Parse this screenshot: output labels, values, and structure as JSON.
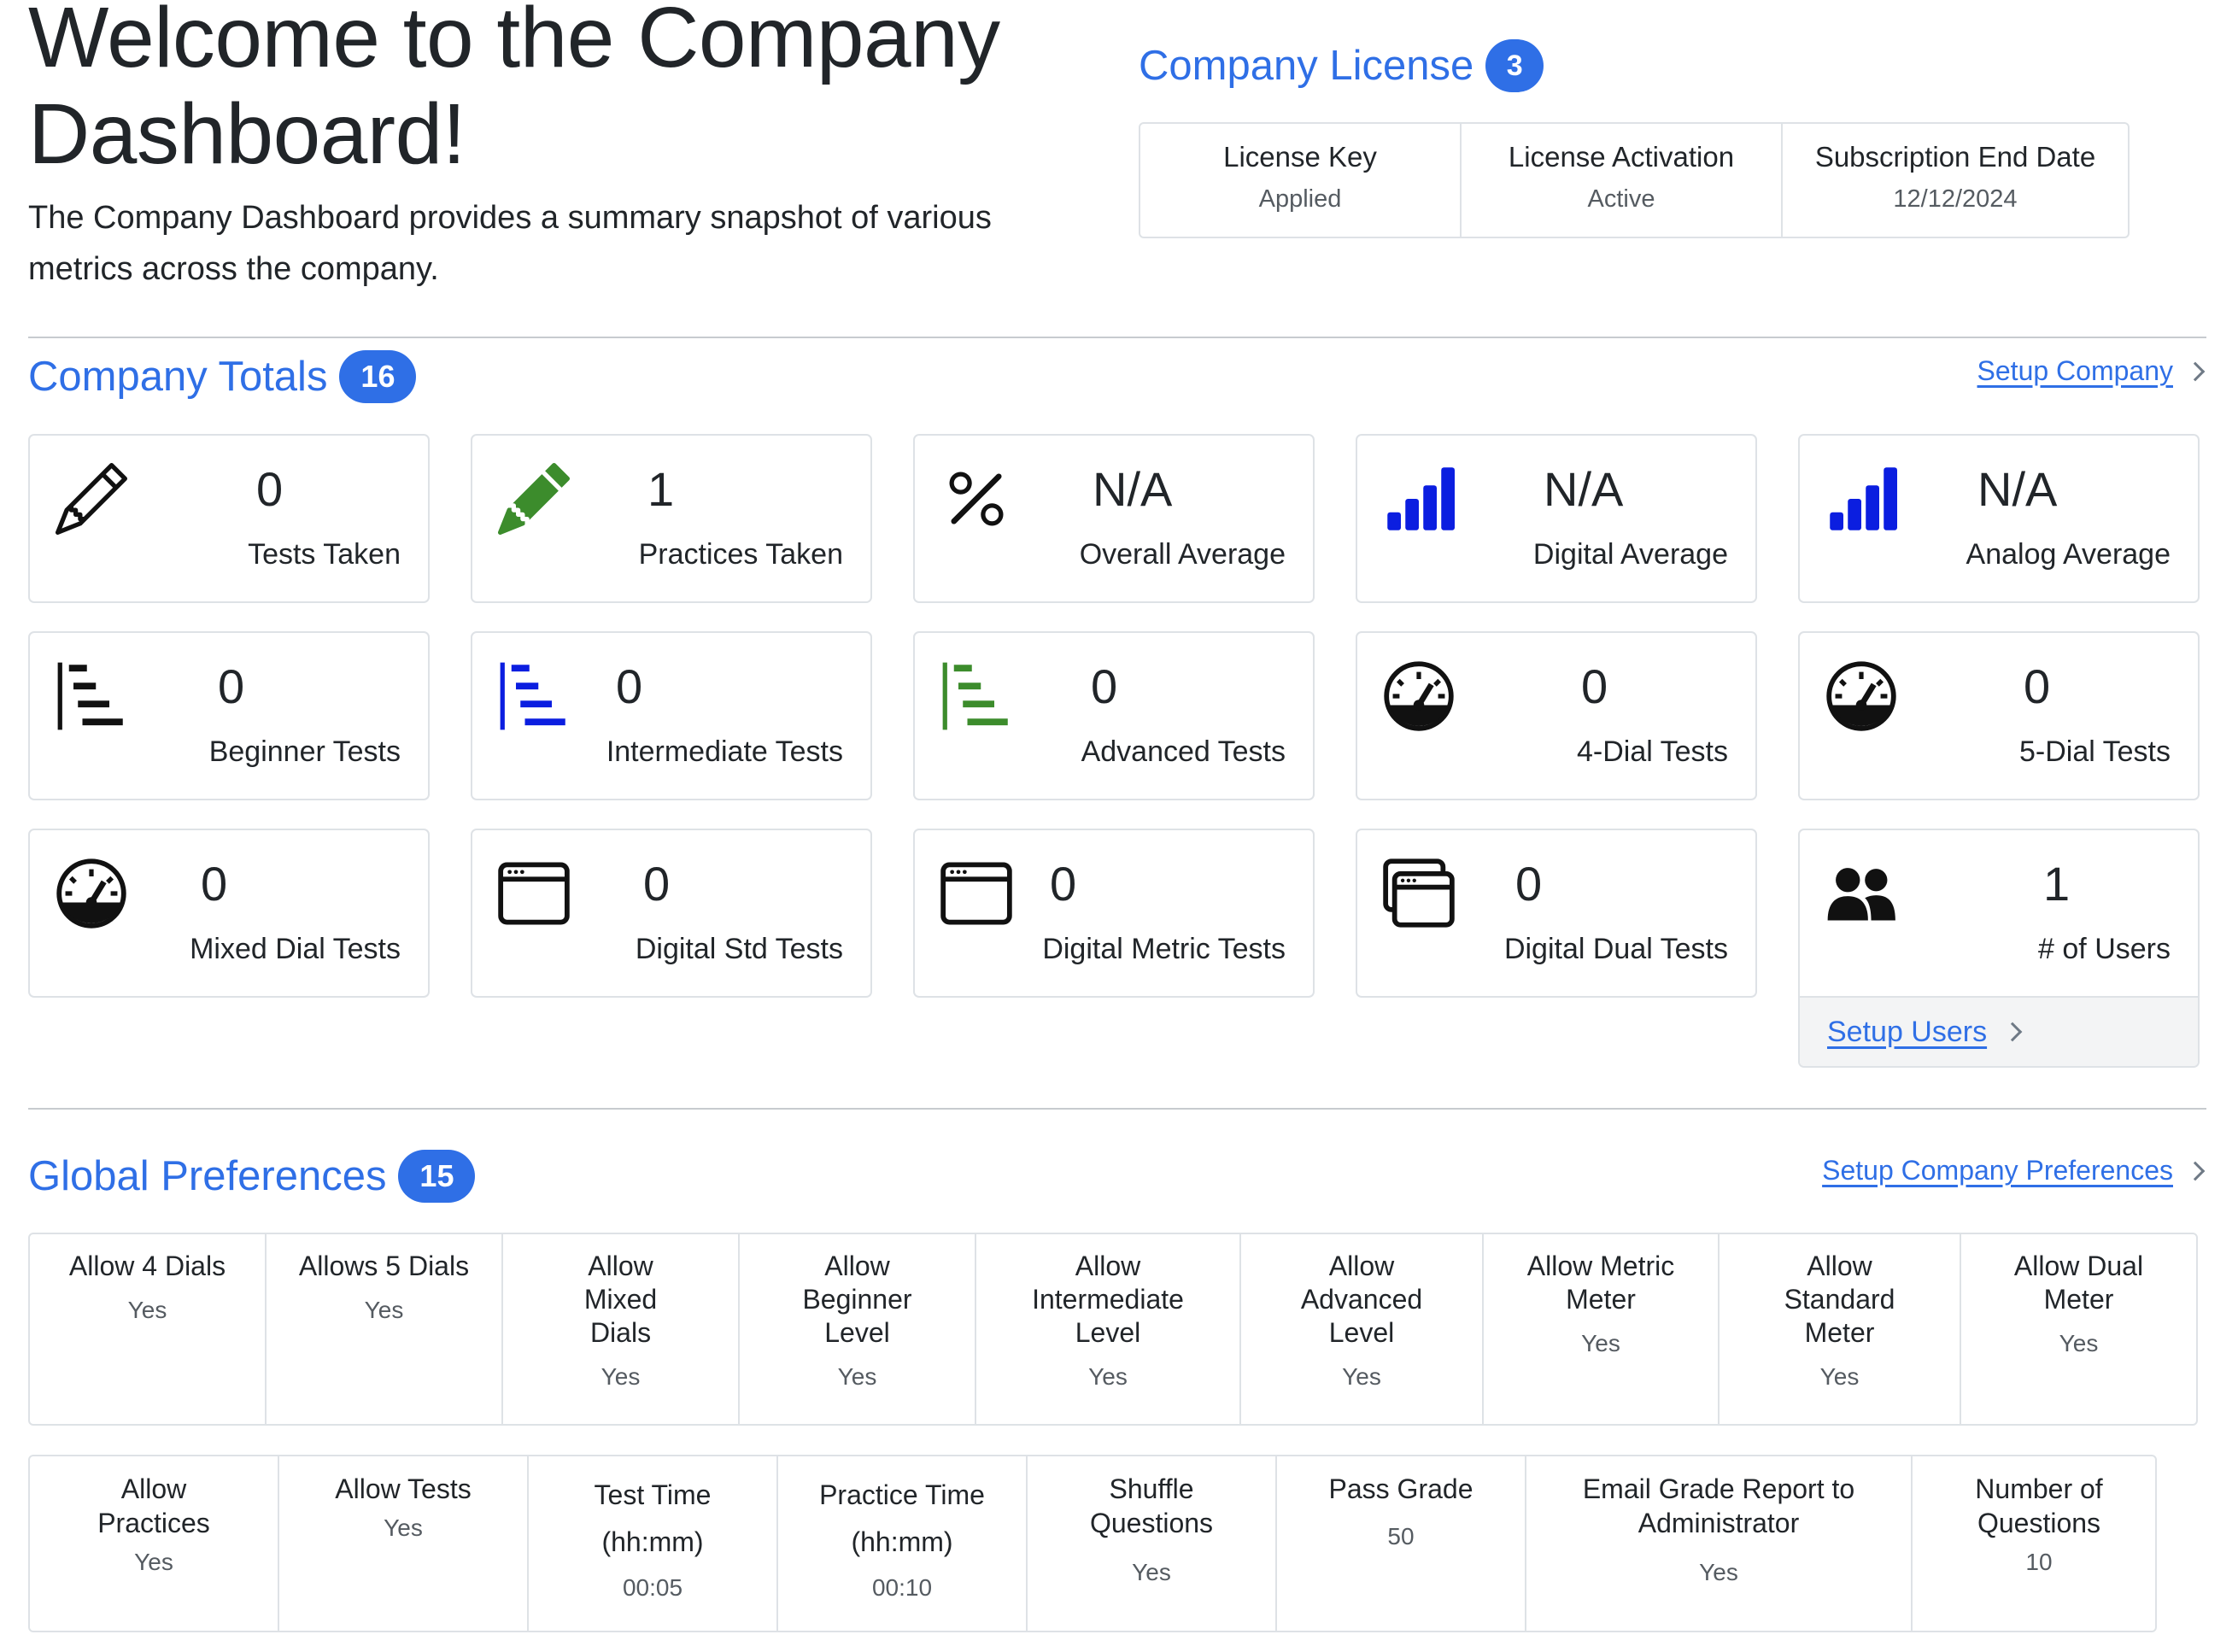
{
  "hero": {
    "title": "Welcome to the Company Dashboard!",
    "subtitle": "The Company Dashboard provides a summary snapshot of various metrics across the company."
  },
  "license": {
    "heading": "Company License",
    "badge": "3",
    "columns": [
      {
        "label": "License Key",
        "value": "Applied"
      },
      {
        "label": "License Activation",
        "value": "Active"
      },
      {
        "label": "Subscription End Date",
        "value": "12/12/2024"
      }
    ]
  },
  "totals": {
    "heading": "Company Totals",
    "badge": "16",
    "setup_link": "Setup Company",
    "cards": [
      {
        "value": "0",
        "label": "Tests Taken",
        "icon": "pencil-outline-icon"
      },
      {
        "value": "1",
        "label": "Practices Taken",
        "icon": "pencil-fill-icon"
      },
      {
        "value": "N/A",
        "label": "Overall Average",
        "icon": "percent-icon"
      },
      {
        "value": "N/A",
        "label": "Digital Average",
        "icon": "bar-chart-icon"
      },
      {
        "value": "N/A",
        "label": "Analog Average",
        "icon": "bar-chart-icon"
      },
      {
        "value": "0",
        "label": "Beginner Tests",
        "icon": "level-list-icon"
      },
      {
        "value": "0",
        "label": "Intermediate Tests",
        "icon": "level-list-icon"
      },
      {
        "value": "0",
        "label": "Advanced Tests",
        "icon": "level-list-icon"
      },
      {
        "value": "0",
        "label": "4-Dial Tests",
        "icon": "speedometer-icon"
      },
      {
        "value": "0",
        "label": "5-Dial Tests",
        "icon": "speedometer-icon"
      },
      {
        "value": "0",
        "label": "Mixed Dial Tests",
        "icon": "speedometer-icon"
      },
      {
        "value": "0",
        "label": "Digital Std Tests",
        "icon": "window-icon"
      },
      {
        "value": "0",
        "label": "Digital Metric Tests",
        "icon": "window-icon"
      },
      {
        "value": "0",
        "label": "Digital Dual Tests",
        "icon": "window-stack-icon"
      },
      {
        "value": "1",
        "label": "# of Users",
        "icon": "people-icon"
      }
    ],
    "users_link": "Setup Users"
  },
  "preferences": {
    "heading": "Global Preferences",
    "badge": "15",
    "setup_link": "Setup Company Preferences",
    "row1": [
      {
        "label": "Allow 4 Dials",
        "value": "Yes"
      },
      {
        "label": "Allows 5 Dials",
        "value": "Yes"
      },
      {
        "label": "Allow Mixed Dials",
        "value": "Yes"
      },
      {
        "label": "Allow Beginner Level",
        "value": "Yes"
      },
      {
        "label": "Allow Intermediate Level",
        "value": "Yes"
      },
      {
        "label": "Allow Advanced Level",
        "value": "Yes"
      },
      {
        "label": "Allow Metric Meter",
        "value": "Yes"
      },
      {
        "label": "Allow Standard Meter",
        "value": "Yes"
      },
      {
        "label": "Allow Dual Meter",
        "value": "Yes"
      }
    ],
    "row2": [
      {
        "label": "Allow Practices",
        "value": "Yes"
      },
      {
        "label": "Allow Tests",
        "value": "Yes"
      },
      {
        "label": "Test Time (hh:mm)",
        "value": "00:05"
      },
      {
        "label": "Practice Time (hh:mm)",
        "value": "00:10"
      },
      {
        "label": "Shuffle Questions",
        "value": "Yes"
      },
      {
        "label": "Pass Grade",
        "value": "50"
      },
      {
        "label": "Email Grade Report to Administrator",
        "value": "Yes"
      },
      {
        "label": "Number of Questions",
        "value": "10"
      }
    ]
  },
  "colors": {
    "accent": "#2f6fe6",
    "icon_blue": "#0b1ee0",
    "icon_green": "#3c8c2c",
    "border": "#dee2e6"
  }
}
